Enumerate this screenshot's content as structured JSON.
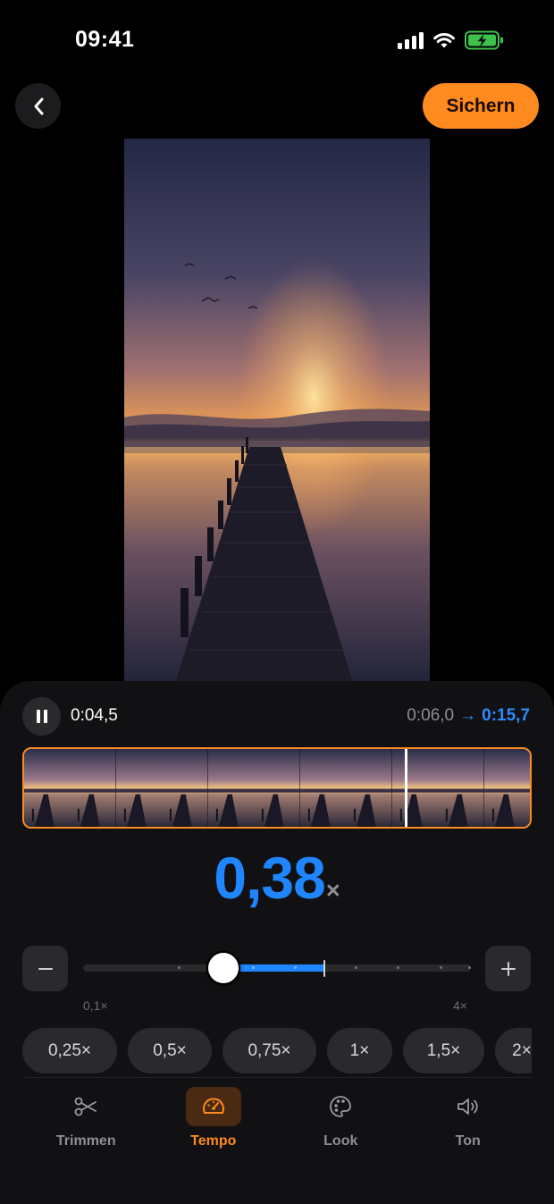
{
  "status_bar": {
    "time": "09:41",
    "icons": [
      "signal-icon",
      "wifi-icon",
      "battery-charging-icon"
    ]
  },
  "top_bar": {
    "back_icon": "chevron-left-icon",
    "save_label": "Sichern",
    "accent_color": "#ff8a1f"
  },
  "playback": {
    "state_icon": "pause-icon",
    "current_time": "0:04,5",
    "original_duration": "0:06,0",
    "arrow": "→",
    "new_duration": "0:15,7"
  },
  "timeline": {
    "frame_count": 11,
    "playhead_fraction": 0.75
  },
  "speed": {
    "value": "0,38",
    "unit": "×",
    "color": "#1f86ff"
  },
  "slider": {
    "min_label": "0,1×",
    "max_label": "4×",
    "thumb_fraction": 0.36,
    "original_marker_fraction": 0.62,
    "minus_icon": "minus-icon",
    "plus_icon": "plus-icon"
  },
  "presets": [
    {
      "label": "0,25×"
    },
    {
      "label": "0,5×"
    },
    {
      "label": "0,75×"
    },
    {
      "label": "1×"
    },
    {
      "label": "1,5×"
    },
    {
      "label": "2×"
    }
  ],
  "tabs": [
    {
      "label": "Trimmen",
      "icon": "scissors-icon",
      "active": false
    },
    {
      "label": "Tempo",
      "icon": "speedometer-icon",
      "active": true
    },
    {
      "label": "Look",
      "icon": "palette-icon",
      "active": false
    },
    {
      "label": "Ton",
      "icon": "speaker-icon",
      "active": false
    }
  ]
}
